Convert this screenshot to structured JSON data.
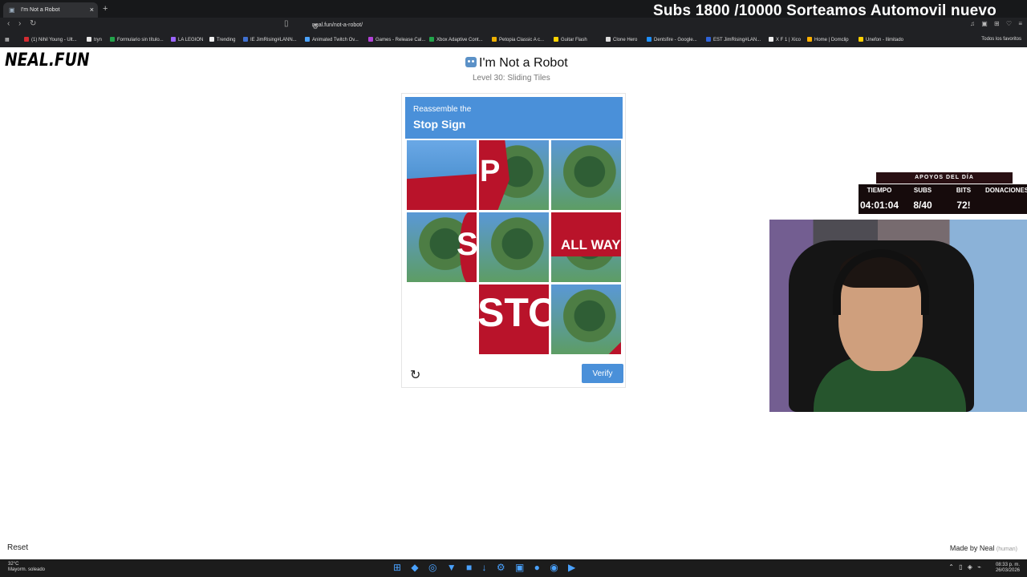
{
  "browser": {
    "tab_title": "I'm Not a Robot",
    "address": "neal.fun/not-a-robot/",
    "bookmarks": [
      "(1) Nihil Young - Ult...",
      "tryn",
      "Formulario sin título...",
      "LA LEGION",
      "Trending",
      "IE JimRising#LANN...",
      "Animated Twitch Ov...",
      "Games - Release Cal...",
      "Xbox Adaptive Cont...",
      "Petopia Classic A c...",
      "Guitar Flash",
      "Clone Hero",
      "Dentsfire - Google...",
      "EST JimRising#LAN...",
      "X F 1 | Xico",
      "Home | Domclip",
      "Unefon - Ilimitado"
    ],
    "all_favorites": "Todos los favoritos"
  },
  "stream": {
    "banner": "Subs 1800 /10000 Sorteamos Automovil nuevo",
    "support_title": "APOYOS DEL DÍA",
    "labels": [
      "TIEMPO",
      "SUBS",
      "BITS",
      "DONACIONES"
    ],
    "values": [
      "04:01:04",
      "8/40",
      "72!",
      ""
    ]
  },
  "page": {
    "logo": "NEAL.FUN",
    "title": "I'm Not a Robot",
    "level": "Level 30: Sliding Tiles",
    "instruction": "Reassemble the",
    "target": "Stop Sign",
    "tile_text": {
      "p": "P",
      "s": "S",
      "all_way": "ALL WAY",
      "sto": "STO"
    },
    "verify": "Verify",
    "reset": "Reset",
    "made_by": "Made by Neal",
    "human": "(human)"
  },
  "taskbar": {
    "temp": "32°C",
    "weather": "Mayorm. soleado",
    "time": "08:33 p. m.",
    "date": "26/03/2026"
  }
}
